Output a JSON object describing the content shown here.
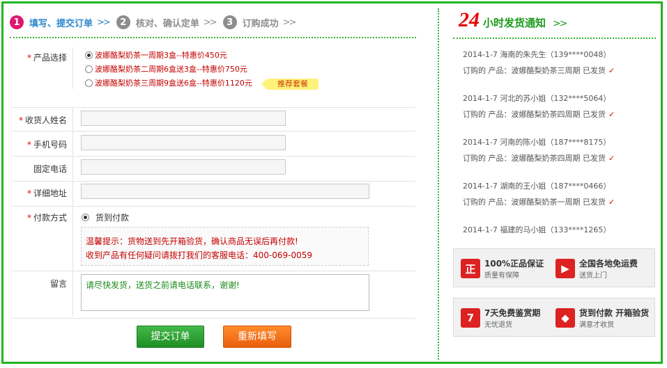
{
  "steps": [
    {
      "num": "1",
      "label": "填写、提交订单",
      "arrow": ">>"
    },
    {
      "num": "2",
      "label": "核对、确认定单",
      "arrow": ">>"
    },
    {
      "num": "3",
      "label": "订购成功",
      "arrow": ">>"
    }
  ],
  "form": {
    "product": {
      "label": "产品选择",
      "options": [
        "波娜酪梨奶茶一周期3盒--特惠价450元",
        "波娜酪梨奶茶二周期6盒送3盒--特惠价750元",
        "波娜酪梨奶茶三周期9盒送6盒--特惠价1120元"
      ],
      "selected_index": 0,
      "badge": "推荐套餐"
    },
    "name": {
      "label": "收货人姓名",
      "value": ""
    },
    "mobile": {
      "label": "手机号码",
      "value": ""
    },
    "phone": {
      "label": "固定电话",
      "value": ""
    },
    "address": {
      "label": "详细地址",
      "value": ""
    },
    "payment": {
      "label": "付款方式",
      "option": "货到付款",
      "tip_line1": "温馨提示：货物送到先开箱验货，确认商品无误后再付款!",
      "tip_line2": "收到产品有任何疑问请拨打我们的客服电话：400-069-0059"
    },
    "message": {
      "label": "留言",
      "value": "请尽快发货，送货之前请电话联系，谢谢!"
    },
    "required_mark": "*",
    "submit_label": "提交订单",
    "reset_label": "重新填写"
  },
  "notice": {
    "title_big": "24",
    "title_small": "小时发货通知",
    "arrow": ">>",
    "items": [
      {
        "line1": "2014-1-7  海南的朱先生（139****0048）",
        "line2": "订购的 产品：波娜酪梨奶茶三周期 已发货"
      },
      {
        "line1": "2014-1-7  河北的苏小姐（132****5064）",
        "line2": "订购的 产品：波娜酪梨奶茶四周期 已发货"
      },
      {
        "line1": "2014-1-7  河南的陈小姐（187****8175）",
        "line2": "订购的 产品：波娜酪梨奶茶四周期 已发货"
      },
      {
        "line1": "2014-1-7  湖南的王小姐（187****0466）",
        "line2": "订购的 产品：波娜酪梨奶茶一周期 已发货"
      },
      {
        "line1": "2014-1-7  福建的马小姐（133****1265）",
        "line2": ""
      }
    ],
    "check": "✓"
  },
  "assurances": [
    {
      "icon": "正",
      "title": "100%正品保证",
      "sub": "质量有保障"
    },
    {
      "icon": "▶",
      "title": "全国各地免运费",
      "sub": "送货上门"
    },
    {
      "icon": "7",
      "title": "7天免费鉴赏期",
      "sub": "无忧退货"
    },
    {
      "icon": "◆",
      "title": "货到付款 开箱验货",
      "sub": "满意才收货"
    }
  ],
  "colors": {
    "border": "#1fb51f",
    "accent_step": "#e0166e",
    "required": "#e60000"
  }
}
